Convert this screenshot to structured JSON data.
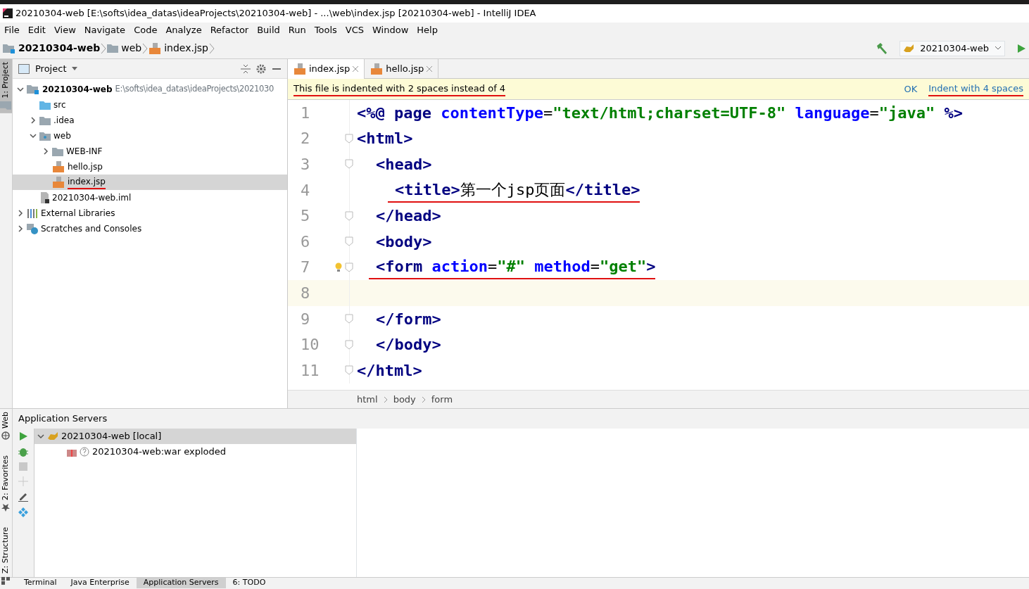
{
  "window": {
    "title": "20210304-web [E:\\softs\\idea_datas\\ideaProjects\\20210304-web] - ...\\web\\index.jsp [20210304-web] - IntelliJ IDEA"
  },
  "menu": [
    "File",
    "Edit",
    "View",
    "Navigate",
    "Code",
    "Analyze",
    "Refactor",
    "Build",
    "Run",
    "Tools",
    "VCS",
    "Window",
    "Help"
  ],
  "breadcrumb": [
    {
      "label": "20210304-web",
      "kind": "project"
    },
    {
      "label": "web",
      "kind": "folder"
    },
    {
      "label": "index.jsp",
      "kind": "jsp"
    }
  ],
  "run_config": {
    "label": "20210304-web"
  },
  "left_stripe": [
    {
      "label": "1: Project",
      "selected": true,
      "kind": "folder"
    },
    {
      "label": "Web",
      "selected": false,
      "kind": "globe"
    },
    {
      "label": "2: Favorites",
      "selected": false,
      "kind": "star"
    },
    {
      "label": "Z: Structure",
      "selected": false,
      "kind": "structure"
    }
  ],
  "project_panel": {
    "title": "Project",
    "tree": [
      {
        "label": "20210304-web",
        "path": "E:\\softs\\idea_datas\\ideaProjects\\2021030",
        "kind": "project",
        "expanded": true,
        "selected": false,
        "annotated": false,
        "children": [
          {
            "label": "src",
            "kind": "src",
            "selected": false,
            "annotated": false
          },
          {
            "label": ".idea",
            "kind": "folder",
            "expanded": false,
            "selected": false,
            "annotated": false
          },
          {
            "label": "web",
            "kind": "webfolder",
            "expanded": true,
            "selected": false,
            "annotated": false,
            "children": [
              {
                "label": "WEB-INF",
                "kind": "folder",
                "expanded": false,
                "selected": false,
                "annotated": false
              },
              {
                "label": "hello.jsp",
                "kind": "jsp",
                "selected": false,
                "annotated": false
              },
              {
                "label": "index.jsp",
                "kind": "jsp",
                "selected": true,
                "annotated": true
              }
            ]
          },
          {
            "label": "20210304-web.iml",
            "kind": "iml",
            "selected": false,
            "annotated": false
          }
        ]
      },
      {
        "label": "External Libraries",
        "kind": "libs",
        "expanded": false,
        "selected": false,
        "annotated": false
      },
      {
        "label": "Scratches and Consoles",
        "kind": "scratch",
        "expanded": false,
        "selected": false,
        "annotated": false
      }
    ]
  },
  "tabs": [
    {
      "label": "index.jsp",
      "selected": true
    },
    {
      "label": "hello.jsp",
      "selected": false
    }
  ],
  "notice": {
    "text": "This file is indented with 2 spaces instead of 4",
    "annotated": true,
    "actions": [
      {
        "label": "OK",
        "annotated": false
      },
      {
        "label": "Indent with 4 spaces",
        "annotated": true
      }
    ]
  },
  "code": [
    {
      "number": "1",
      "kind": "level0",
      "fold": false,
      "current": false,
      "bulb": false,
      "tokens": [
        {
          "kind": "tag",
          "text": "<%@ page "
        },
        {
          "kind": "attr",
          "text": "contentType"
        },
        {
          "kind": "plain",
          "text": "="
        },
        {
          "kind": "string",
          "text": "\"text/html;charset=UTF-8\""
        },
        {
          "kind": "attr",
          "text": " language"
        },
        {
          "kind": "plain",
          "text": "="
        },
        {
          "kind": "string",
          "text": "\"java\""
        },
        {
          "kind": "tag",
          "text": " %>"
        }
      ]
    },
    {
      "number": "2",
      "kind": "level0",
      "fold": true,
      "current": false,
      "bulb": false,
      "tokens": [
        {
          "kind": "tag",
          "text": "<html>"
        }
      ]
    },
    {
      "number": "3",
      "kind": "level1",
      "fold": true,
      "current": false,
      "bulb": false,
      "tokens": [
        {
          "kind": "tag",
          "text": "<head>"
        }
      ]
    },
    {
      "number": "4",
      "kind": "level2",
      "fold": false,
      "current": false,
      "bulb": false,
      "annotated": true,
      "tokens": [
        {
          "kind": "tag",
          "text": "<title>"
        },
        {
          "kind": "plain",
          "text": "第一个jsp页面"
        },
        {
          "kind": "tag",
          "text": "</title>"
        }
      ]
    },
    {
      "number": "5",
      "kind": "level1",
      "fold": true,
      "current": false,
      "bulb": false,
      "tokens": [
        {
          "kind": "tag",
          "text": "</head>"
        }
      ]
    },
    {
      "number": "6",
      "kind": "level1",
      "fold": true,
      "current": false,
      "bulb": false,
      "tokens": [
        {
          "kind": "tag",
          "text": "<body>"
        }
      ]
    },
    {
      "number": "7",
      "kind": "level1",
      "fold": true,
      "current": false,
      "bulb": true,
      "annotated": true,
      "tokens": [
        {
          "kind": "tag",
          "text": "<form"
        },
        {
          "kind": "attr",
          "text": " action"
        },
        {
          "kind": "plain",
          "text": "="
        },
        {
          "kind": "string",
          "text": "\"#\""
        },
        {
          "kind": "attr",
          "text": " method"
        },
        {
          "kind": "plain",
          "text": "="
        },
        {
          "kind": "string",
          "text": "\"get\""
        },
        {
          "kind": "tag",
          "text": ">"
        }
      ]
    },
    {
      "number": "8",
      "fold": false,
      "current": true,
      "bulb": false
    },
    {
      "number": "9",
      "kind": "level1",
      "fold": true,
      "current": false,
      "bulb": false,
      "tokens": [
        {
          "kind": "tag",
          "text": "</form>"
        }
      ]
    },
    {
      "number": "10",
      "kind": "level1",
      "fold": true,
      "current": false,
      "bulb": false,
      "tokens": [
        {
          "kind": "tag",
          "text": "</body>"
        }
      ]
    },
    {
      "number": "11",
      "kind": "level0",
      "fold": true,
      "current": false,
      "bulb": false,
      "tokens": [
        {
          "kind": "tag",
          "text": "</html>"
        }
      ]
    }
  ],
  "editor_breadcrumb": [
    "html",
    "body",
    "form"
  ],
  "app_servers": {
    "title": "Application Servers",
    "tree": [
      {
        "label": "20210304-web [local]",
        "expanded": true,
        "selected": true,
        "children": [
          {
            "label": "20210304-web:war exploded",
            "selected": false
          }
        ]
      }
    ]
  },
  "bottom_tabs": [
    {
      "label": "Terminal",
      "selected": false
    },
    {
      "label": "Java Enterprise",
      "selected": false
    },
    {
      "label": "Application Servers",
      "selected": true
    },
    {
      "label": "6: TODO",
      "selected": false
    }
  ]
}
